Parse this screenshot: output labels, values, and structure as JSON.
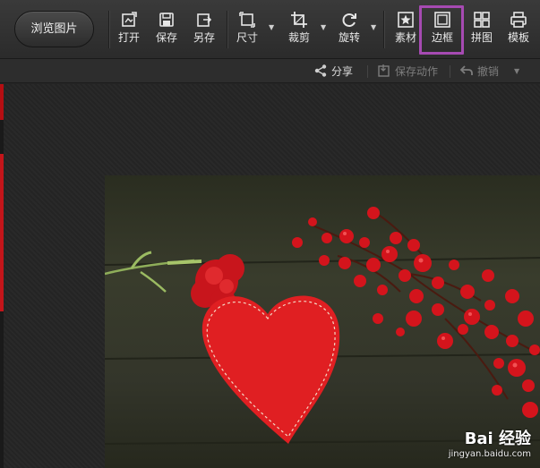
{
  "toolbar": {
    "browse_label": "浏览图片",
    "tools": {
      "open": "打开",
      "save": "保存",
      "save_as": "另存",
      "size": "尺寸",
      "crop": "裁剪",
      "rotate": "旋转",
      "material": "素材",
      "border": "边框",
      "collage": "拼图",
      "template": "模板"
    },
    "highlight_color": "#a64ab2"
  },
  "actionbar": {
    "share": "分享",
    "save_action": "保存动作",
    "undo": "撤销"
  },
  "watermark": {
    "brand": "Bai 经验",
    "url": "jingyan.baidu.com"
  },
  "icons": [
    "open-icon",
    "save-icon",
    "save-as-icon",
    "size-icon",
    "crop-icon",
    "rotate-icon",
    "material-icon",
    "border-icon",
    "collage-icon",
    "template-icon",
    "share-icon",
    "save-action-icon",
    "undo-icon"
  ]
}
